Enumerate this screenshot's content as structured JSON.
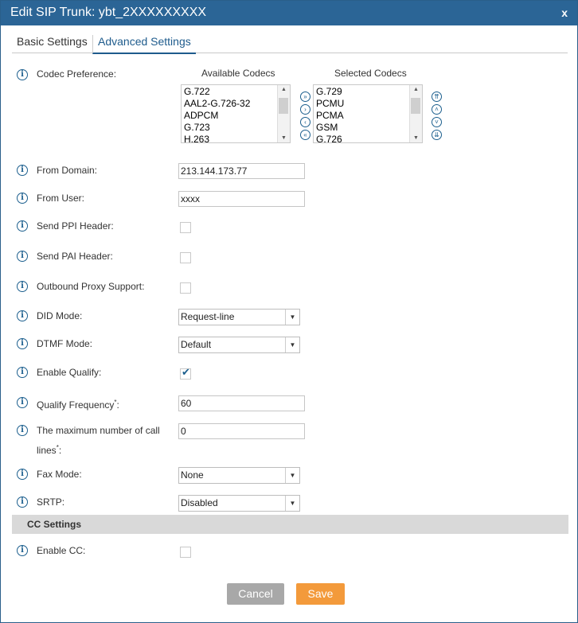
{
  "dialog": {
    "title": "Edit SIP Trunk: ybt_2XXXXXXXXX",
    "close": "x"
  },
  "tabs": {
    "basic": "Basic Settings",
    "advanced": "Advanced Settings"
  },
  "info_glyph": "i",
  "codec": {
    "label": "Codec Preference:",
    "available_header": "Available Codecs",
    "selected_header": "Selected Codecs",
    "available": [
      "G.722",
      "AAL2-G.726-32",
      "ADPCM",
      "G.723",
      "H.263"
    ],
    "selected": [
      "G.729",
      "PCMU",
      "PCMA",
      "GSM",
      "G.726"
    ]
  },
  "fields": {
    "from_domain": {
      "label": "From Domain:",
      "value": "213.144.173.77"
    },
    "from_user": {
      "label": "From User:",
      "value": "xxxx"
    },
    "send_ppi": {
      "label": "Send PPI Header:"
    },
    "send_pai": {
      "label": "Send PAI Header:"
    },
    "outbound_proxy": {
      "label": "Outbound Proxy Support:"
    },
    "did_mode": {
      "label": "DID Mode:",
      "value": "Request-line"
    },
    "dtmf_mode": {
      "label": "DTMF Mode:",
      "value": "Default"
    },
    "enable_qualify": {
      "label": "Enable Qualify:",
      "checked": true
    },
    "qualify_freq": {
      "label": "Qualify Frequency",
      "value": "60"
    },
    "max_lines": {
      "label_line1": "The maximum number of call",
      "label_line2": "lines",
      "value": "0"
    },
    "fax_mode": {
      "label": "Fax Mode:",
      "value": "None"
    },
    "srtp": {
      "label": "SRTP:",
      "value": "Disabled"
    },
    "enable_cc": {
      "label": "Enable CC:"
    }
  },
  "required_mark": "*",
  "colon": ":",
  "section": {
    "cc": "CC Settings"
  },
  "buttons": {
    "cancel": "Cancel",
    "save": "Save"
  },
  "colors": {
    "titlebar": "#2b6596",
    "accent": "#1c5f8e",
    "save": "#f39a3b",
    "cancel": "#a8a8a8"
  }
}
